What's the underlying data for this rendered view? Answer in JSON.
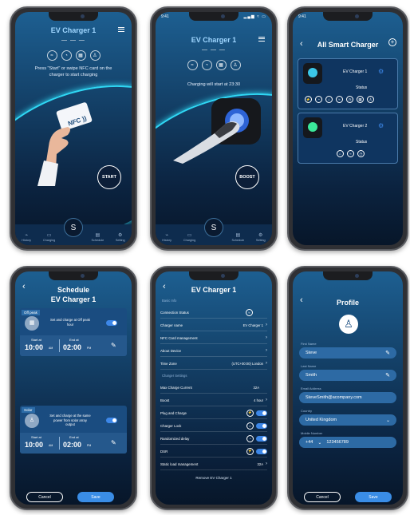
{
  "status": {
    "time": "9:41",
    "right": "▂▄▆ ≈ ▭"
  },
  "screen1": {
    "title": "EV Charger 1",
    "dashes": "— — —",
    "message": "Press \"Start\" or swipe NFC card on the charger to start charging",
    "nfc": "NFC",
    "start": "START"
  },
  "screen2": {
    "title": "EV Charger 1",
    "dashes": "— — —",
    "message": "Charging will start at 23:30",
    "boost": "BOOST"
  },
  "tabs": {
    "history": "History",
    "charging": "Charging",
    "schedule": "Schedule",
    "setting": "Setting"
  },
  "screen3": {
    "title": "All Smart Charger",
    "chargers": [
      {
        "name": "EV Charger 1",
        "status": "Status"
      },
      {
        "name": "EV Charger 2",
        "status": "Status"
      }
    ]
  },
  "screen4": {
    "title": "Schedule",
    "subtitle": "EV Charger 1",
    "offpeak": {
      "tag": "Off peak",
      "desc": "Set and charge at Off peak hour",
      "start_lbl": "Start at",
      "start": "10:00",
      "start_ampm": "AM",
      "end_lbl": "End at",
      "end": "02:00",
      "end_ampm": "PM"
    },
    "solar": {
      "tag": "Solar",
      "desc": "Set and charge at the same power from solar array output",
      "start_lbl": "Start at",
      "start": "10:00",
      "start_ampm": "AM",
      "end_lbl": "End at",
      "end": "02:00",
      "end_ampm": "PM"
    },
    "cancel": "Cancel",
    "save": "Save"
  },
  "screen5": {
    "title": "EV Charger 1",
    "basic_info": "Basic Info",
    "connection": "Connection Status",
    "charger_name": "Charger name",
    "charger_name_val": "EV Charger 1",
    "nfc": "NFC Card management",
    "about": "About Device",
    "timezone": "Time Zone",
    "timezone_val": "(UTC+00:00) London",
    "settings": "Charger Settings",
    "max_current": "Max Charge Current",
    "max_current_val": "32A",
    "boost": "Boost",
    "boost_val": "4 hour",
    "plug": "Plug and Charge",
    "lock": "Charger Lock",
    "delay": "Randomized delay",
    "dsr": "DSR",
    "static": "Static load management",
    "static_val": "32A",
    "remove": "Remove EV Charger 1"
  },
  "screen6": {
    "title": "Profile",
    "first_lbl": "First Name",
    "first": "Steve",
    "last_lbl": "Last Name",
    "last": "Smith",
    "email_lbl": "Email Address",
    "email": "SteveSmith@acompany.com",
    "country_lbl": "Country",
    "country": "United Kingdom",
    "mobile_lbl": "Mobile Number",
    "code": "+44",
    "mobile": "123456789",
    "cancel": "Cancel",
    "save": "Save"
  }
}
